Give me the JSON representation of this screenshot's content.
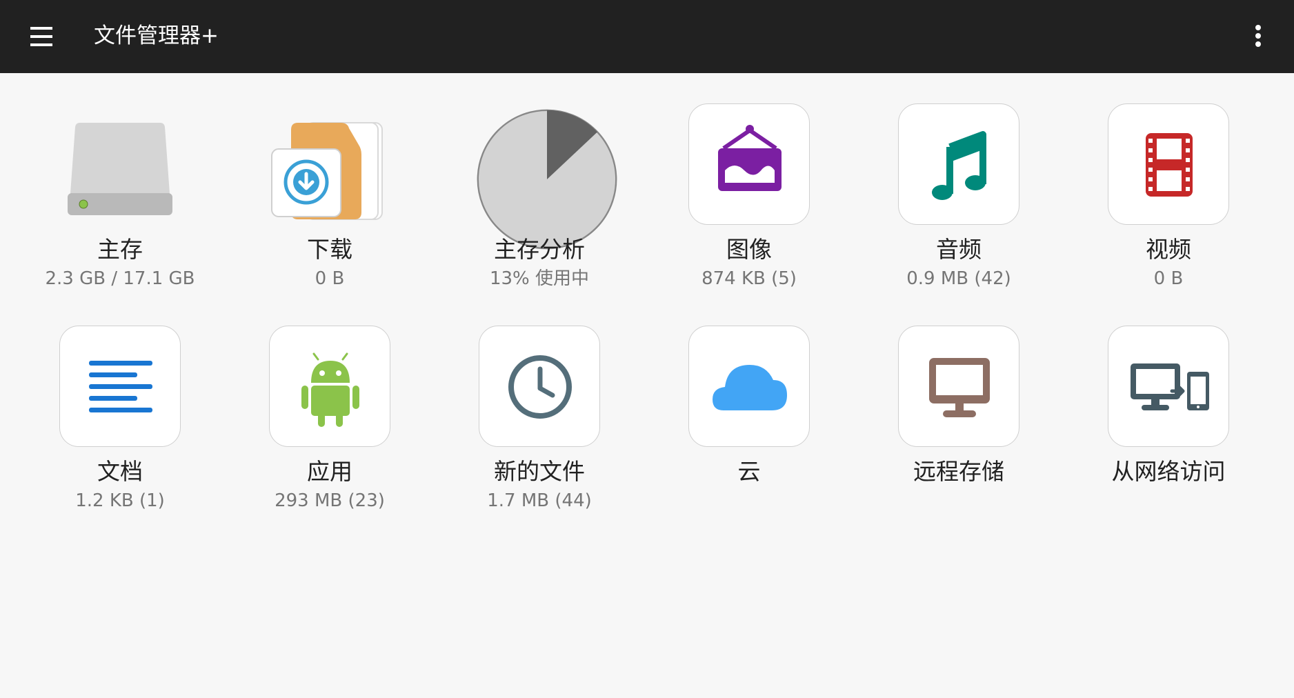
{
  "app": {
    "title": "文件管理器+",
    "menu_icon": "hamburger-menu-icon",
    "more_icon": "more-vert-icon"
  },
  "tiles": [
    {
      "label": "主存",
      "sub": "2.3 GB / 17.1 GB",
      "icon": "hard-drive-icon"
    },
    {
      "label": "下载",
      "sub": "0 B",
      "icon": "download-folder-icon"
    },
    {
      "label": "主存分析",
      "sub": "13% 使用中",
      "icon": "storage-pie-icon",
      "used_fraction": 0.13
    },
    {
      "label": "图像",
      "sub": "874 KB (5)",
      "icon": "image-icon",
      "color": "#7b1fa2"
    },
    {
      "label": "音频",
      "sub": "0.9 MB (42)",
      "icon": "music-note-icon",
      "color": "#00897b"
    },
    {
      "label": "视频",
      "sub": "0 B",
      "icon": "film-icon",
      "color": "#c62828"
    },
    {
      "label": "文档",
      "sub": "1.2 KB (1)",
      "icon": "document-icon",
      "color": "#1976d2"
    },
    {
      "label": "应用",
      "sub": "293 MB (23)",
      "icon": "android-icon",
      "color": "#8bc34a"
    },
    {
      "label": "新的文件",
      "sub": "1.7 MB (44)",
      "icon": "clock-icon",
      "color": "#546e7a"
    },
    {
      "label": "云",
      "sub": "",
      "icon": "cloud-icon",
      "color": "#42a5f5"
    },
    {
      "label": "远程存储",
      "sub": "",
      "icon": "monitor-icon",
      "color": "#8d6e63"
    },
    {
      "label": "从网络访问",
      "sub": "",
      "icon": "network-devices-icon",
      "color": "#455a64"
    }
  ]
}
